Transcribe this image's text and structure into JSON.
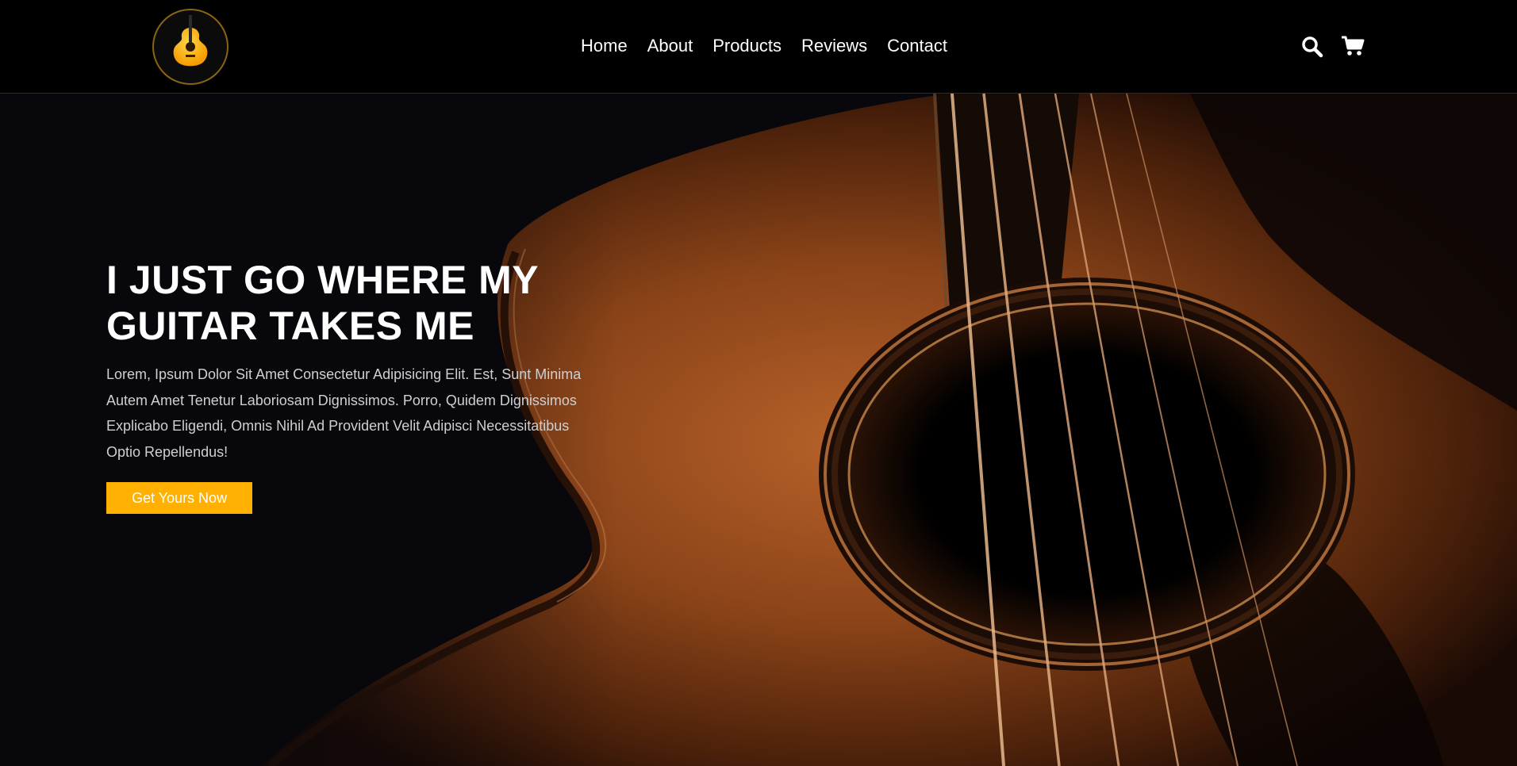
{
  "header": {
    "logo_icon": "guitar-logo-icon",
    "nav": [
      {
        "label": "Home"
      },
      {
        "label": "About"
      },
      {
        "label": "Products"
      },
      {
        "label": "Reviews"
      },
      {
        "label": "Contact"
      }
    ],
    "search_icon": "search-icon",
    "cart_icon": "cart-icon"
  },
  "hero": {
    "title": "I JUST GO WHERE MY GUITAR TAKES ME",
    "text": "Lorem, Ipsum Dolor Sit Amet Consectetur Adipisicing Elit. Est, Sunt Minima Autem Amet Tenetur Laboriosam Dignissimos. Porro, Quidem Dignissimos Explicabo Eligendi, Omnis Nihil Ad Provident Velit Adipisci Necessitatibus Optio Repellendus!",
    "cta_label": "Get Yours Now"
  },
  "colors": {
    "accent": "#ffb000",
    "header_bg": "#000000",
    "hero_bg": "#08070c"
  }
}
